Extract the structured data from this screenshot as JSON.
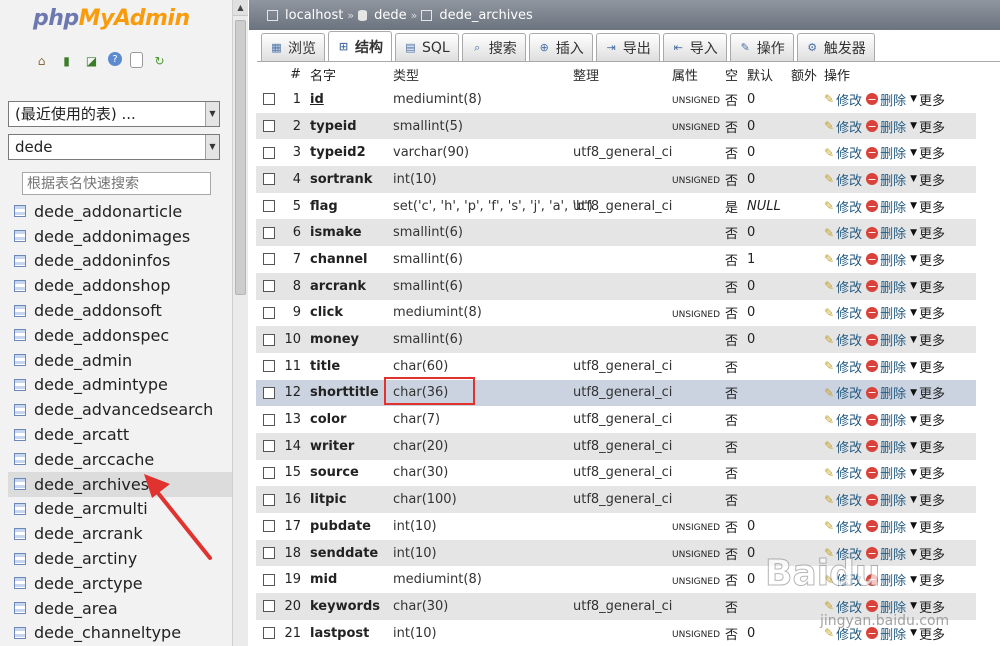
{
  "logo": {
    "php": "php",
    "my": "MyAdmin"
  },
  "nav": {
    "recent_select": "(最近使用的表) ...",
    "db_select": "dede",
    "search_placeholder": "根据表名快速搜索",
    "tables": [
      "dede_addonarticle",
      "dede_addonimages",
      "dede_addoninfos",
      "dede_addonshop",
      "dede_addonsoft",
      "dede_addonspec",
      "dede_admin",
      "dede_admintype",
      "dede_advancedsearch",
      "dede_arcatt",
      "dede_arccache",
      "dede_archives",
      "dede_arcmulti",
      "dede_arcrank",
      "dede_arctiny",
      "dede_arctype",
      "dede_area",
      "dede_channeltype"
    ],
    "active_table": "dede_archives"
  },
  "breadcrumb": {
    "server": "localhost",
    "database": "dede",
    "table": "dede_archives",
    "separator": "»"
  },
  "tabs": [
    {
      "label": "浏览",
      "icon": "browse-icon"
    },
    {
      "label": "结构",
      "icon": "structure-icon",
      "active": true
    },
    {
      "label": "SQL",
      "icon": "sql-icon"
    },
    {
      "label": "搜索",
      "icon": "search-icon"
    },
    {
      "label": "插入",
      "icon": "insert-icon"
    },
    {
      "label": "导出",
      "icon": "export-icon"
    },
    {
      "label": "导入",
      "icon": "import-icon"
    },
    {
      "label": "操作",
      "icon": "wrench-icon"
    },
    {
      "label": "触发器",
      "icon": "triggers-icon"
    }
  ],
  "columns_header": {
    "num": "#",
    "name": "名字",
    "type": "类型",
    "collation": "整理",
    "attributes": "属性",
    "null": "空",
    "default": "默认",
    "extra": "额外",
    "action": "操作"
  },
  "actions": {
    "edit": "修改",
    "drop": "删除",
    "more": "更多"
  },
  "fields": [
    {
      "num": "1",
      "name": "id",
      "type": "mediumint(8)",
      "collation": "",
      "attributes": "UNSIGNED",
      "null": "否",
      "default": "0",
      "primary": true
    },
    {
      "num": "2",
      "name": "typeid",
      "type": "smallint(5)",
      "collation": "",
      "attributes": "UNSIGNED",
      "null": "否",
      "default": "0"
    },
    {
      "num": "3",
      "name": "typeid2",
      "type": "varchar(90)",
      "collation": "utf8_general_ci",
      "attributes": "",
      "null": "否",
      "default": "0"
    },
    {
      "num": "4",
      "name": "sortrank",
      "type": "int(10)",
      "collation": "",
      "attributes": "UNSIGNED",
      "null": "否",
      "default": "0"
    },
    {
      "num": "5",
      "name": "flag",
      "type": "set('c', 'h', 'p', 'f', 's', 'j', 'a', 'b')",
      "collation": "utf8_general_ci",
      "attributes": "",
      "null": "是",
      "default": "NULL",
      "default_is_null": true
    },
    {
      "num": "6",
      "name": "ismake",
      "type": "smallint(6)",
      "collation": "",
      "attributes": "",
      "null": "否",
      "default": "0"
    },
    {
      "num": "7",
      "name": "channel",
      "type": "smallint(6)",
      "collation": "",
      "attributes": "",
      "null": "否",
      "default": "1"
    },
    {
      "num": "8",
      "name": "arcrank",
      "type": "smallint(6)",
      "collation": "",
      "attributes": "",
      "null": "否",
      "default": "0"
    },
    {
      "num": "9",
      "name": "click",
      "type": "mediumint(8)",
      "collation": "",
      "attributes": "UNSIGNED",
      "null": "否",
      "default": "0"
    },
    {
      "num": "10",
      "name": "money",
      "type": "smallint(6)",
      "collation": "",
      "attributes": "",
      "null": "否",
      "default": "0"
    },
    {
      "num": "11",
      "name": "title",
      "type": "char(60)",
      "collation": "utf8_general_ci",
      "attributes": "",
      "null": "否",
      "default": ""
    },
    {
      "num": "12",
      "name": "shorttitle",
      "type": "char(36)",
      "collation": "utf8_general_ci",
      "attributes": "",
      "null": "否",
      "default": "",
      "hover": true
    },
    {
      "num": "13",
      "name": "color",
      "type": "char(7)",
      "collation": "utf8_general_ci",
      "attributes": "",
      "null": "否",
      "default": ""
    },
    {
      "num": "14",
      "name": "writer",
      "type": "char(20)",
      "collation": "utf8_general_ci",
      "attributes": "",
      "null": "否",
      "default": ""
    },
    {
      "num": "15",
      "name": "source",
      "type": "char(30)",
      "collation": "utf8_general_ci",
      "attributes": "",
      "null": "否",
      "default": ""
    },
    {
      "num": "16",
      "name": "litpic",
      "type": "char(100)",
      "collation": "utf8_general_ci",
      "attributes": "",
      "null": "否",
      "default": ""
    },
    {
      "num": "17",
      "name": "pubdate",
      "type": "int(10)",
      "collation": "",
      "attributes": "UNSIGNED",
      "null": "否",
      "default": "0"
    },
    {
      "num": "18",
      "name": "senddate",
      "type": "int(10)",
      "collation": "",
      "attributes": "UNSIGNED",
      "null": "否",
      "default": "0"
    },
    {
      "num": "19",
      "name": "mid",
      "type": "mediumint(8)",
      "collation": "",
      "attributes": "UNSIGNED",
      "null": "否",
      "default": "0"
    },
    {
      "num": "20",
      "name": "keywords",
      "type": "char(30)",
      "collation": "utf8_general_ci",
      "attributes": "",
      "null": "否",
      "default": ""
    },
    {
      "num": "21",
      "name": "lastpost",
      "type": "int(10)",
      "collation": "",
      "attributes": "UNSIGNED",
      "null": "否",
      "default": "0"
    }
  ],
  "watermark": {
    "text": "Baidu",
    "sub": "jingyan.baidu.com"
  },
  "colors": {
    "highlight": "#e0322e",
    "topbar": "#6b737e",
    "link": "#235a81",
    "hover_row": "#cbd3e0"
  }
}
